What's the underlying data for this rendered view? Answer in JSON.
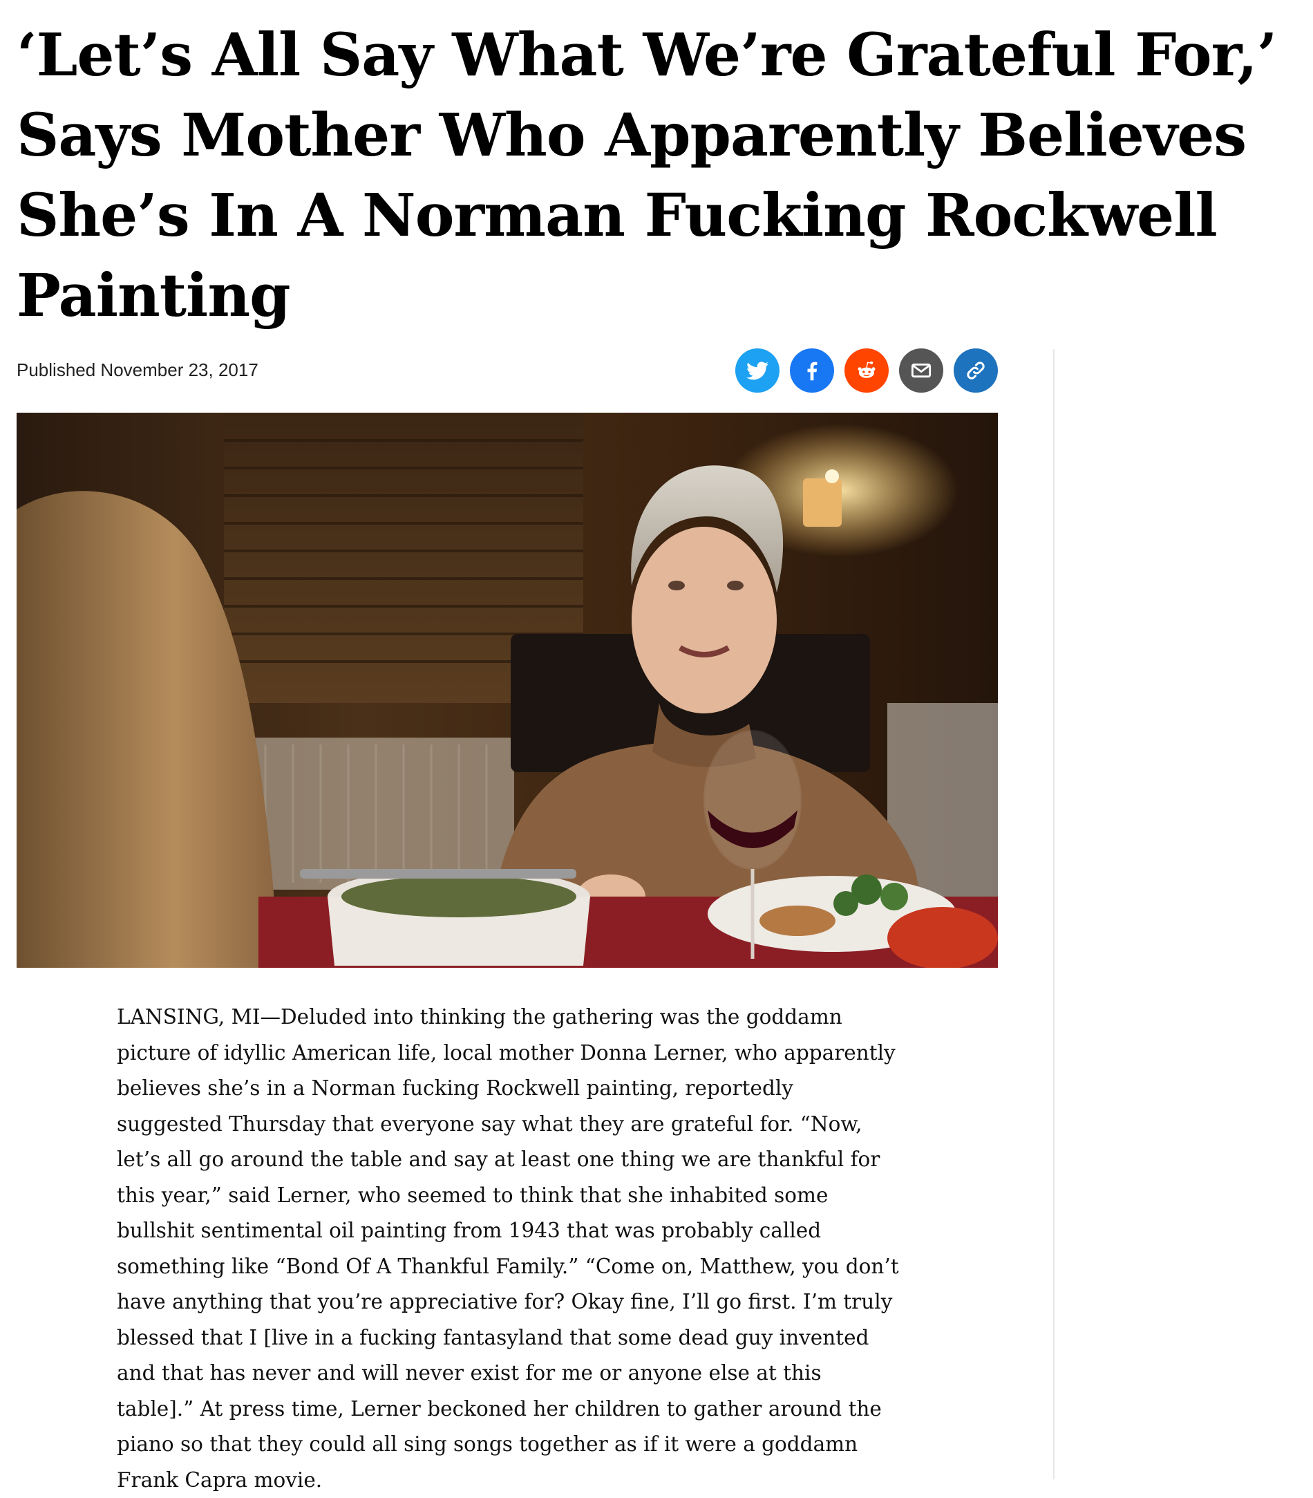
{
  "article": {
    "headline": "‘Let’s All Say What We’re Grateful For,’ Says Mother Who Apparently Believes She’s In A Norman Fucking Rockwell Painting",
    "published_label": "Published November 23, 2017",
    "body": "LANSING, MI—Deluded into thinking the gathering was the goddamn picture of idyllic American life, local mother Donna Lerner, who apparently believes she’s in a Norman fucking Rockwell painting, reportedly suggested Thursday that everyone say what they are grateful for. “Now, let’s all go around the table and say at least one thing we are thankful for this year,” said Lerner, who seemed to think that she inhabited some bullshit sentimental oil painting from 1943 that was probably called something like “Bond Of A Thankful Family.” “Come on, Matthew, you don’t have anything that you’re appreciative for? Okay fine, I’ll go first. I’m truly blessed that I [live in a fucking fantasyland that some dead guy invented and that has never and will never exist for me or anyone else at this table].” At press time, Lerner beckoned her children to gather around the piano so that they could all sing songs together as if it were a goddamn Frank Capra movie."
  },
  "share": {
    "buttons": [
      {
        "name": "twitter",
        "icon": "twitter-bird-icon",
        "color": "#1da1f2"
      },
      {
        "name": "facebook",
        "icon": "facebook-f-icon",
        "color": "#1877f2"
      },
      {
        "name": "reddit",
        "icon": "reddit-alien-icon",
        "color": "#ff4500"
      },
      {
        "name": "email",
        "icon": "envelope-icon",
        "color": "#555555"
      },
      {
        "name": "copy-link",
        "icon": "link-icon",
        "color": "#1e73be"
      }
    ]
  },
  "hero_image": {
    "description_icon": "photo-elderly-woman-at-dinner-table"
  }
}
